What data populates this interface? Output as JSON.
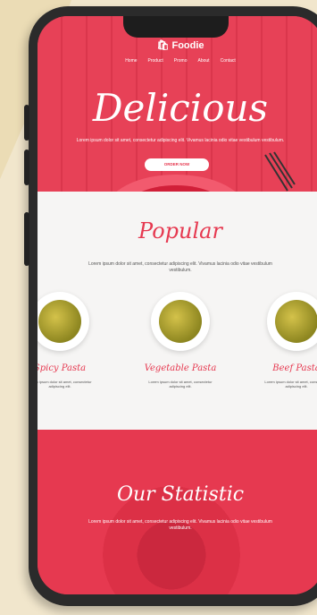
{
  "brand": {
    "name": "Foodie",
    "accent": "#e63950"
  },
  "nav": {
    "items": [
      "Home",
      "Product",
      "Promo",
      "About",
      "Contact"
    ]
  },
  "hero": {
    "title": "Delicious",
    "description": "Lorem ipsum dolor sit amet, consectetur adipiscing elit. Vivamus lacinia odio vitae vestibulum vestibulum.",
    "cta_label": "ORDER NOW"
  },
  "popular": {
    "title": "Popular",
    "description": "Lorem ipsum dolor sit amet, consectetur adipiscing elit. Vivamus lacinia odio vitae vestibulum vestibulum.",
    "dishes": [
      {
        "name": "Spicy Pasta",
        "description": "Lorem ipsum dolor sit amet, consectetur adipiscing elit."
      },
      {
        "name": "Vegetable Pasta",
        "description": "Lorem ipsum dolor sit amet, consectetur adipiscing elit."
      },
      {
        "name": "Beef Pasta",
        "description": "Lorem ipsum dolor sit amet, consectetur adipiscing elit."
      }
    ]
  },
  "stats": {
    "title": "Our Statistic",
    "description": "Lorem ipsum dolor sit amet, consectetur adipiscing elit. Vivamus lacinia odio vitae vestibulum vestibulum."
  }
}
